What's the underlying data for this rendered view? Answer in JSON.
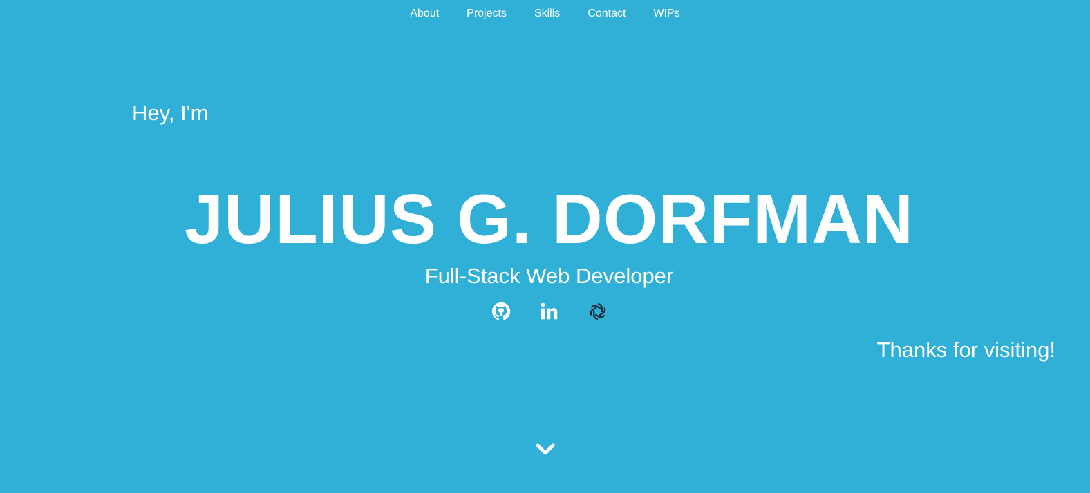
{
  "nav": {
    "items": [
      {
        "label": "About"
      },
      {
        "label": "Projects"
      },
      {
        "label": "Skills"
      },
      {
        "label": "Contact"
      },
      {
        "label": "WIPs"
      }
    ]
  },
  "hero": {
    "greeting": "Hey, I'm",
    "name": "JULIUS G. DORFMAN",
    "subtitle": "Full-Stack Web Developer",
    "thanks": "Thanks for visiting!"
  },
  "social": [
    {
      "icon": "github-icon"
    },
    {
      "icon": "linkedin-icon"
    },
    {
      "icon": "openai-icon"
    }
  ],
  "scroll": {
    "icon": "chevron-down-icon"
  },
  "colors": {
    "background": "#31b0d7",
    "text": "#ffffff",
    "accent_icon": "#1b2a33"
  }
}
